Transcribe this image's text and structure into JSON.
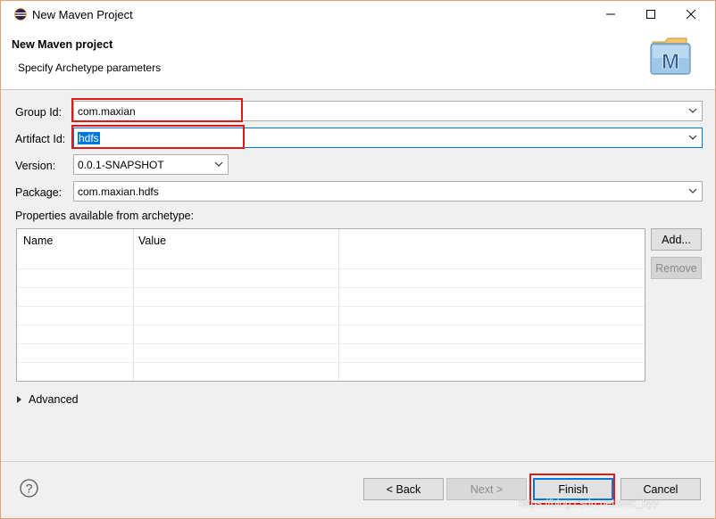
{
  "window": {
    "title": "New Maven Project",
    "controls": {
      "minimize": "—",
      "maximize": "☐",
      "close": "✕"
    }
  },
  "header": {
    "title": "New Maven project",
    "subtitle": "Specify Archetype parameters",
    "logo_letter": "M"
  },
  "form": {
    "group_id": {
      "label": "Group Id:",
      "value": "com.maxian"
    },
    "artifact_id": {
      "label": "Artifact Id:",
      "value": "hdfs"
    },
    "version": {
      "label": "Version:",
      "value": "0.0.1-SNAPSHOT"
    },
    "package": {
      "label": "Package:",
      "value": "com.maxian.hdfs"
    }
  },
  "properties": {
    "label": "Properties available from archetype:",
    "columns": [
      "Name",
      "Value"
    ],
    "rows": []
  },
  "side_buttons": {
    "add": "Add...",
    "remove": "Remove"
  },
  "advanced": {
    "label": "Advanced"
  },
  "footer": {
    "help": "?",
    "back": "< Back",
    "next": "Next >",
    "finish": "Finish",
    "cancel": "Cancel"
  },
  "watermark": "https://blog.csdn.net/swc_byy",
  "colors": {
    "accent": "#0078d7",
    "highlight_box": "#e01818"
  }
}
